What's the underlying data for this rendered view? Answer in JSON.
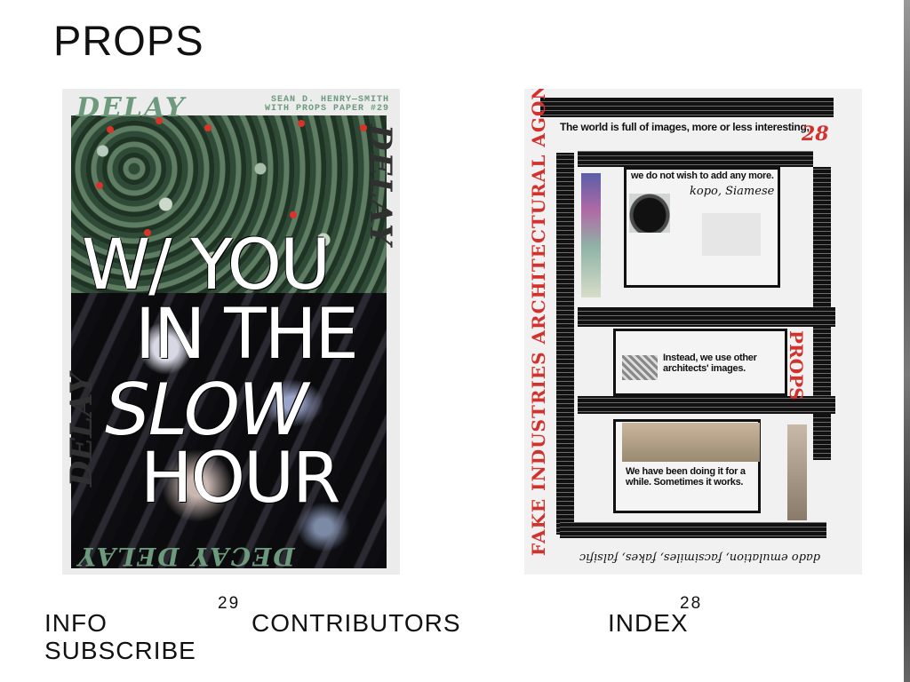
{
  "site": {
    "title": "PROPS"
  },
  "covers": {
    "issue_29": {
      "number": "29",
      "header_left": "DELAY",
      "header_right_line1": "SEAN D. HENRY—SMITH",
      "header_right_line2": "WITH PROPS PAPER #29",
      "side_left": "DELAY",
      "side_right": "DELAY",
      "bottom_band": "DECAY DELAY",
      "title_line1": "W/ YOU",
      "title_line2": "IN THE",
      "title_line3": "SLOW",
      "title_line4": "HOUR"
    },
    "issue_28": {
      "number": "28",
      "badge_number": "28",
      "headline": "The world is full of images, more or less interesting,",
      "text_block_1": "we do not wish to add any more.",
      "text_block_2_line1": "Instead, we use other",
      "text_block_2_line2": "architects' images.",
      "text_block_3_line1": "We have been doing it for a",
      "text_block_3_line2": "while. Sometimes it works.",
      "vertical_red": "FAKE INDUSTRIES ARCHITECTURAL AGONISM",
      "vertical_red_props": "PROPS",
      "caption_fraktur_1": "kopo, Siamese",
      "caption_fraktur_2": "dado emulation, facsimiles, fakes, falsific"
    }
  },
  "nav": {
    "info": "INFO",
    "subscribe": "SUBSCRIBE",
    "contributors": "CONTRIBUTORS",
    "index": "INDEX"
  },
  "colors": {
    "background": "#ffffff",
    "text": "#111111",
    "cover29_accent": "#6d9a7d",
    "cover28_red": "#d2322d"
  }
}
